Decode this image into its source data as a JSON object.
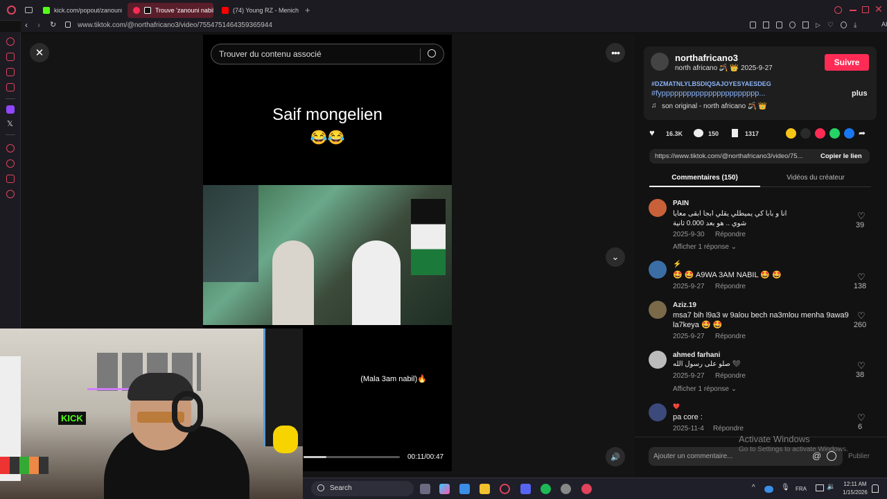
{
  "browser": {
    "tabs": [
      {
        "label": "kick.com/popout/zanouni",
        "color": "#53fc18"
      },
      {
        "label": "Trouve 'zanouni nabil'",
        "color": "#ff2d55"
      },
      {
        "label": "(74) Young RZ - Menich K",
        "color": "#ff0000"
      }
    ],
    "url": "www.tiktok.com/@northafricano3/video/7554751464359365944",
    "ai_label": "AI"
  },
  "video": {
    "search_placeholder": "Trouver du contenu associé",
    "caption_title": "Saif mongelien",
    "caption_emoji": "😂😂",
    "subtitle": "(Mala 3am nabil)🔥",
    "time": "00:11/00:47",
    "progress": 0.234
  },
  "post": {
    "username": "northafricano3",
    "display_name": "north africano 🪃 👑",
    "date": "· 2025-9-27",
    "follow_label": "Suivre",
    "hashtag1": "#DZMATNLYLBSDIQSAJOYESYAESDEG",
    "hashtag2": "#fyppppppppppppppppppppppp...",
    "more_label": "plus",
    "sound": "son original - north africano 🪃 👑",
    "likes": "16.3K",
    "comments": "150",
    "saves": "1317",
    "link": "https://www.tiktok.com/@northafricano3/video/75...",
    "copy_label": "Copier le lien",
    "tab_comments": "Commentaires (150)",
    "tab_videos": "Vidéos du créateur"
  },
  "comments": [
    {
      "user": "PAIN",
      "text": "انا و بابا كي يميطلي يقلي ابجا ابقى معايا شوي .. هو بعد 0.000 ثانية",
      "date": "2025-9-30",
      "reply": "Répondre",
      "likes": "39",
      "more": "Afficher 1 réponse"
    },
    {
      "user": "⚡",
      "text": "🤩 🤩 A9WA 3AM NABIL 🤩 🤩",
      "date": "2025-9-27",
      "reply": "Répondre",
      "likes": "138",
      "more": ""
    },
    {
      "user": "Aziz.19",
      "text": "msa7 bih l9a3 w 9alou bech na3mlou menha 9awa9 la7keya 🤩 🤩",
      "date": "2025-9-27",
      "reply": "Répondre",
      "likes": "260",
      "more": ""
    },
    {
      "user": "ahmed farhani",
      "text": "صلو على رسول الله 🖤",
      "date": "2025-9-27",
      "reply": "Répondre",
      "likes": "38",
      "more": "Afficher 1 réponse"
    },
    {
      "user": "❤️",
      "text": "pa core :",
      "date": "2025-11-4",
      "reply": "Répondre",
      "likes": "6",
      "more": ""
    }
  ],
  "comment_input": {
    "placeholder": "Ajouter un commentaire...",
    "publish": "Publier"
  },
  "windows": {
    "activate_title": "Activate Windows",
    "activate_sub": "Go to Settings to activate Windows.",
    "search": "Search",
    "lang": "FRA",
    "time": "12:11 AM",
    "date": "1/15/2026"
  },
  "webcam": {
    "sign": "KICK"
  }
}
